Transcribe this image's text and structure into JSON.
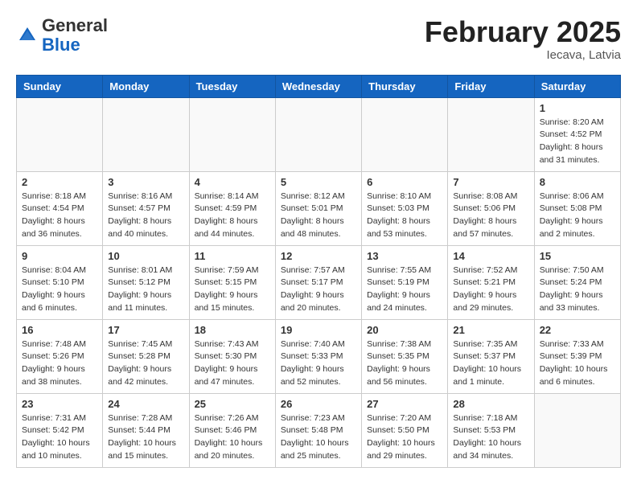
{
  "header": {
    "logo_general": "General",
    "logo_blue": "Blue",
    "month_title": "February 2025",
    "location": "Iecava, Latvia"
  },
  "weekdays": [
    "Sunday",
    "Monday",
    "Tuesday",
    "Wednesday",
    "Thursday",
    "Friday",
    "Saturday"
  ],
  "weeks": [
    [
      {
        "day": "",
        "info": ""
      },
      {
        "day": "",
        "info": ""
      },
      {
        "day": "",
        "info": ""
      },
      {
        "day": "",
        "info": ""
      },
      {
        "day": "",
        "info": ""
      },
      {
        "day": "",
        "info": ""
      },
      {
        "day": "1",
        "info": "Sunrise: 8:20 AM\nSunset: 4:52 PM\nDaylight: 8 hours and 31 minutes."
      }
    ],
    [
      {
        "day": "2",
        "info": "Sunrise: 8:18 AM\nSunset: 4:54 PM\nDaylight: 8 hours and 36 minutes."
      },
      {
        "day": "3",
        "info": "Sunrise: 8:16 AM\nSunset: 4:57 PM\nDaylight: 8 hours and 40 minutes."
      },
      {
        "day": "4",
        "info": "Sunrise: 8:14 AM\nSunset: 4:59 PM\nDaylight: 8 hours and 44 minutes."
      },
      {
        "day": "5",
        "info": "Sunrise: 8:12 AM\nSunset: 5:01 PM\nDaylight: 8 hours and 48 minutes."
      },
      {
        "day": "6",
        "info": "Sunrise: 8:10 AM\nSunset: 5:03 PM\nDaylight: 8 hours and 53 minutes."
      },
      {
        "day": "7",
        "info": "Sunrise: 8:08 AM\nSunset: 5:06 PM\nDaylight: 8 hours and 57 minutes."
      },
      {
        "day": "8",
        "info": "Sunrise: 8:06 AM\nSunset: 5:08 PM\nDaylight: 9 hours and 2 minutes."
      }
    ],
    [
      {
        "day": "9",
        "info": "Sunrise: 8:04 AM\nSunset: 5:10 PM\nDaylight: 9 hours and 6 minutes."
      },
      {
        "day": "10",
        "info": "Sunrise: 8:01 AM\nSunset: 5:12 PM\nDaylight: 9 hours and 11 minutes."
      },
      {
        "day": "11",
        "info": "Sunrise: 7:59 AM\nSunset: 5:15 PM\nDaylight: 9 hours and 15 minutes."
      },
      {
        "day": "12",
        "info": "Sunrise: 7:57 AM\nSunset: 5:17 PM\nDaylight: 9 hours and 20 minutes."
      },
      {
        "day": "13",
        "info": "Sunrise: 7:55 AM\nSunset: 5:19 PM\nDaylight: 9 hours and 24 minutes."
      },
      {
        "day": "14",
        "info": "Sunrise: 7:52 AM\nSunset: 5:21 PM\nDaylight: 9 hours and 29 minutes."
      },
      {
        "day": "15",
        "info": "Sunrise: 7:50 AM\nSunset: 5:24 PM\nDaylight: 9 hours and 33 minutes."
      }
    ],
    [
      {
        "day": "16",
        "info": "Sunrise: 7:48 AM\nSunset: 5:26 PM\nDaylight: 9 hours and 38 minutes."
      },
      {
        "day": "17",
        "info": "Sunrise: 7:45 AM\nSunset: 5:28 PM\nDaylight: 9 hours and 42 minutes."
      },
      {
        "day": "18",
        "info": "Sunrise: 7:43 AM\nSunset: 5:30 PM\nDaylight: 9 hours and 47 minutes."
      },
      {
        "day": "19",
        "info": "Sunrise: 7:40 AM\nSunset: 5:33 PM\nDaylight: 9 hours and 52 minutes."
      },
      {
        "day": "20",
        "info": "Sunrise: 7:38 AM\nSunset: 5:35 PM\nDaylight: 9 hours and 56 minutes."
      },
      {
        "day": "21",
        "info": "Sunrise: 7:35 AM\nSunset: 5:37 PM\nDaylight: 10 hours and 1 minute."
      },
      {
        "day": "22",
        "info": "Sunrise: 7:33 AM\nSunset: 5:39 PM\nDaylight: 10 hours and 6 minutes."
      }
    ],
    [
      {
        "day": "23",
        "info": "Sunrise: 7:31 AM\nSunset: 5:42 PM\nDaylight: 10 hours and 10 minutes."
      },
      {
        "day": "24",
        "info": "Sunrise: 7:28 AM\nSunset: 5:44 PM\nDaylight: 10 hours and 15 minutes."
      },
      {
        "day": "25",
        "info": "Sunrise: 7:26 AM\nSunset: 5:46 PM\nDaylight: 10 hours and 20 minutes."
      },
      {
        "day": "26",
        "info": "Sunrise: 7:23 AM\nSunset: 5:48 PM\nDaylight: 10 hours and 25 minutes."
      },
      {
        "day": "27",
        "info": "Sunrise: 7:20 AM\nSunset: 5:50 PM\nDaylight: 10 hours and 29 minutes."
      },
      {
        "day": "28",
        "info": "Sunrise: 7:18 AM\nSunset: 5:53 PM\nDaylight: 10 hours and 34 minutes."
      },
      {
        "day": "",
        "info": ""
      }
    ]
  ]
}
